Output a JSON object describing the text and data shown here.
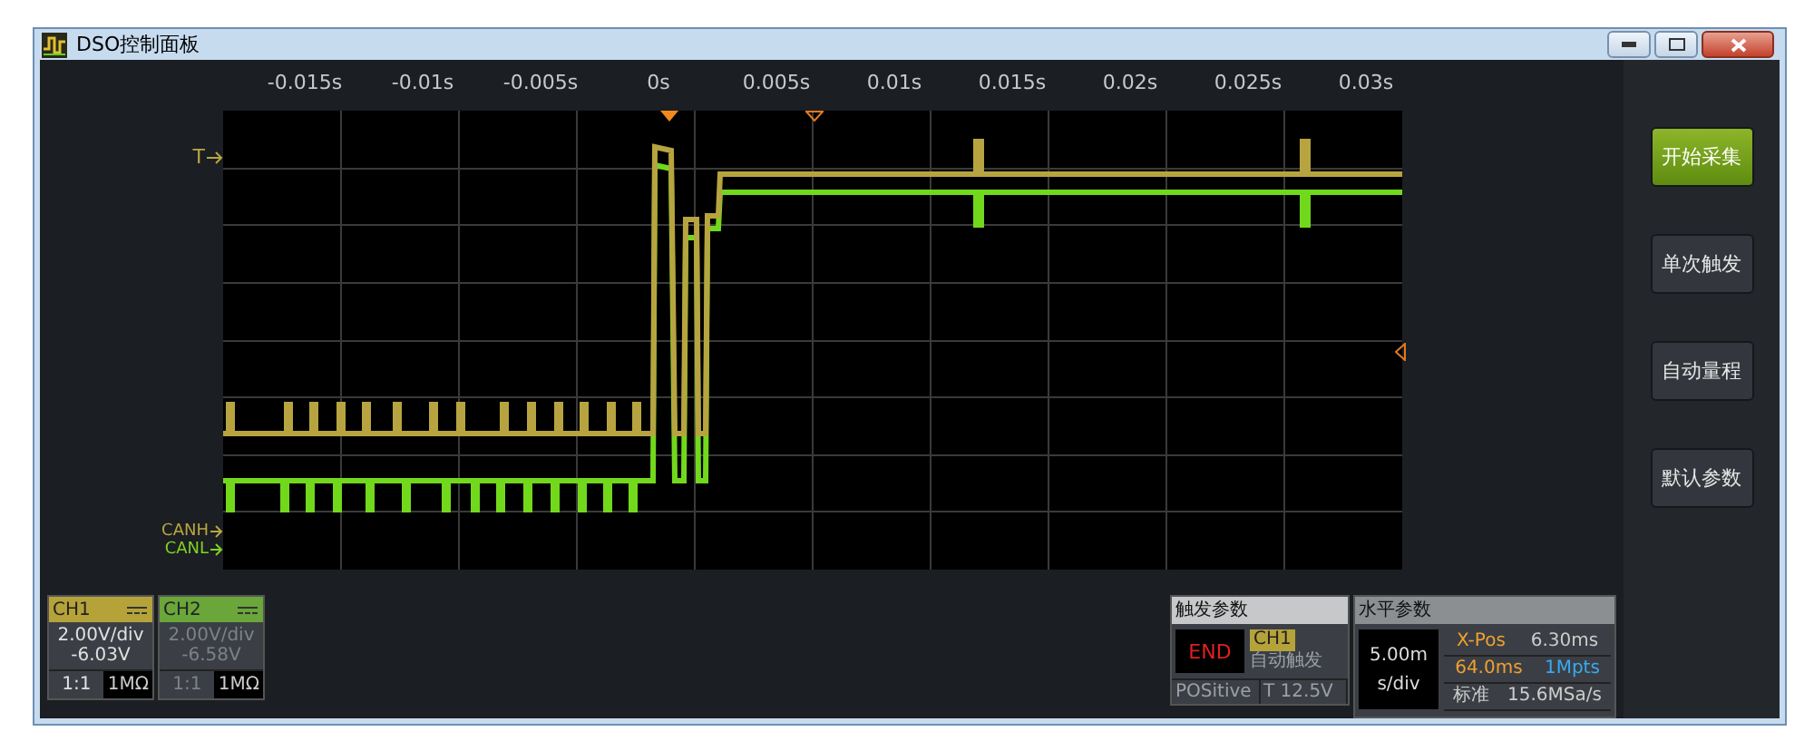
{
  "window": {
    "title": "DSO控制面板"
  },
  "time_labels": [
    "-0.015s",
    "-0.01s",
    "-0.005s",
    "0s",
    "0.005s",
    "0.01s",
    "0.015s",
    "0.02s",
    "0.025s",
    "0.03s"
  ],
  "trigger_marker": {
    "label": "T"
  },
  "channel_markers": [
    {
      "label": "CANH",
      "color": "#b8a640"
    },
    {
      "label": "CANL",
      "color": "#7ed321"
    }
  ],
  "channels": [
    {
      "name": "CH1",
      "color": "#b5a33a",
      "disabled": false,
      "scale": "2.00V/div",
      "offset": "-6.03V",
      "probe": "1:1",
      "impedance": "1MΩ"
    },
    {
      "name": "CH2",
      "color": "#6aa63a",
      "disabled": true,
      "scale": "2.00V/div",
      "offset": "-6.58V",
      "probe": "1:1",
      "impedance": "1MΩ"
    }
  ],
  "trigger": {
    "title": "触发参数",
    "status": "END",
    "source": "CH1",
    "mode": "自动触发",
    "slope": "POSitive",
    "level": "T 12.5V"
  },
  "horizontal": {
    "title": "水平参数",
    "timebase": "5.00m",
    "timebase_unit": "s/div",
    "xpos_label": "X-Pos",
    "xpos": "6.30ms",
    "length": "64.0ms",
    "points": "1Mpts",
    "mode": "标准",
    "sample_rate": "15.6MSa/s"
  },
  "buttons": [
    {
      "label": "开始采集",
      "kind": "primary"
    },
    {
      "label": "单次触发",
      "kind": "normal"
    },
    {
      "label": "自动量程",
      "kind": "normal"
    },
    {
      "label": "默认参数",
      "kind": "normal"
    }
  ]
}
